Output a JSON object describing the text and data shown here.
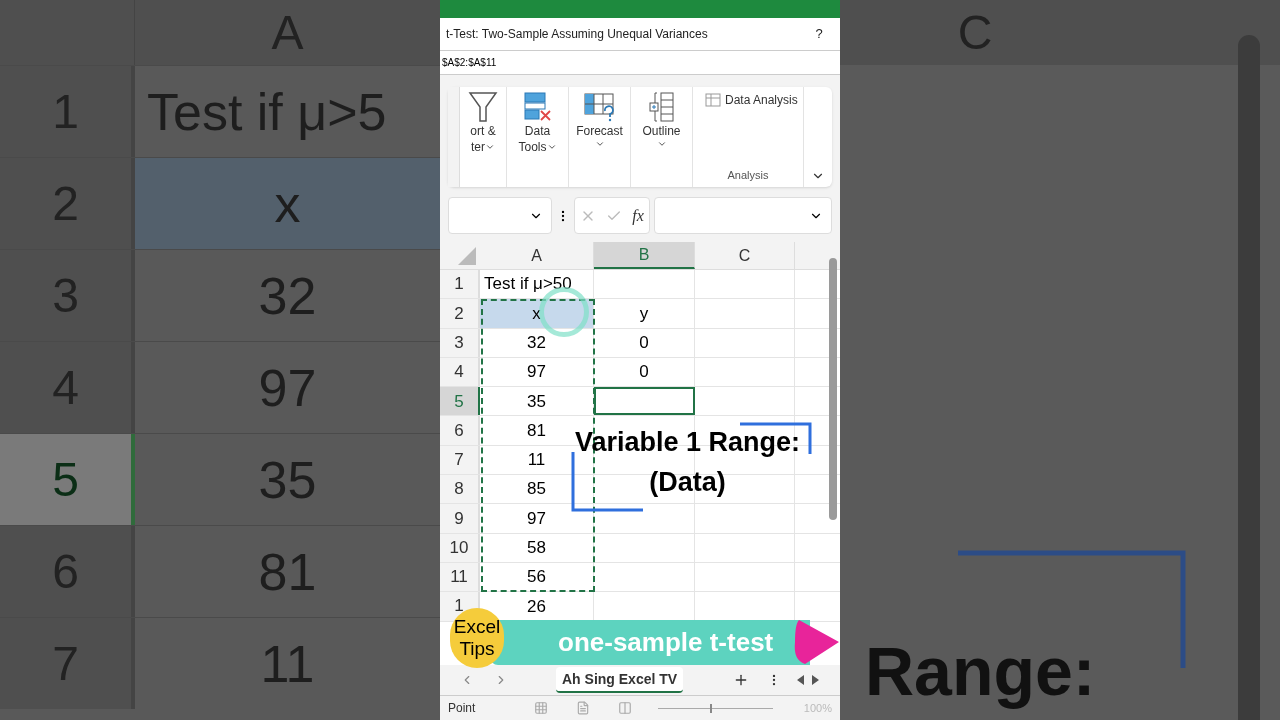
{
  "background_left": {
    "column": "A",
    "rows": [
      {
        "number": "1",
        "value": "Test if μ>5",
        "selected": false
      },
      {
        "number": "2",
        "value": "x",
        "selected": false
      },
      {
        "number": "3",
        "value": "32",
        "selected": false
      },
      {
        "number": "4",
        "value": "97",
        "selected": false
      },
      {
        "number": "5",
        "value": "35",
        "selected": true
      },
      {
        "number": "6",
        "value": "81",
        "selected": false
      },
      {
        "number": "7",
        "value": "11",
        "selected": false
      }
    ]
  },
  "background_right": {
    "column": "C",
    "caption": "Range:"
  },
  "dialog": {
    "title": "t-Test: Two-Sample Assuming Unequal Variances",
    "help": "?",
    "range_value": "$A$2:$A$11"
  },
  "ribbon": {
    "buttons": [
      {
        "kind": "filter",
        "lines": [
          "ort &",
          "ter"
        ],
        "dropdown": true
      },
      {
        "kind": "tools",
        "lines": [
          "Data",
          "Tools"
        ],
        "dropdown": true
      },
      {
        "kind": "forecast",
        "lines": [
          "Forecast"
        ],
        "dropdown": true
      },
      {
        "kind": "outline",
        "lines": [
          "Outline"
        ],
        "dropdown": true
      }
    ],
    "data_analysis": "Data Analysis",
    "group_label": "Analysis"
  },
  "formula_bar": {
    "function_symbol": "fx"
  },
  "sheet": {
    "columns": [
      {
        "label": "A",
        "selected": false
      },
      {
        "label": "B",
        "selected": true
      },
      {
        "label": "C",
        "selected": false
      }
    ],
    "rows": [
      {
        "number": "1",
        "selected": false,
        "a": "Test if μ>50"
      },
      {
        "number": "2",
        "selected": false,
        "a": "x",
        "b": "y"
      },
      {
        "number": "3",
        "selected": false,
        "a": "32",
        "b": "0"
      },
      {
        "number": "4",
        "selected": false,
        "a": "97",
        "b": "0"
      },
      {
        "number": "5",
        "selected": true,
        "a": "35"
      },
      {
        "number": "6",
        "selected": false,
        "a": "81"
      },
      {
        "number": "7",
        "selected": false,
        "a": "11"
      },
      {
        "number": "8",
        "selected": false,
        "a": "85"
      },
      {
        "number": "9",
        "selected": false,
        "a": "97"
      },
      {
        "number": "10",
        "selected": false,
        "a": "58"
      },
      {
        "number": "11",
        "selected": false,
        "a": "56"
      },
      {
        "number": "1",
        "selected": false,
        "a": "26"
      }
    ]
  },
  "overlay": {
    "lines": [
      "Variable 1 Range:",
      "(Data)"
    ]
  },
  "banner": {
    "badge": [
      "Excel",
      "Tips"
    ],
    "title": "one-sample t-test"
  },
  "sheet_tabs": [
    {
      "label": "Ah Sing Excel TV",
      "selected": true
    }
  ],
  "status_bar": {
    "mode": "Point",
    "zoom_slider": {
      "level": 0.45
    },
    "zoom": "100%"
  }
}
